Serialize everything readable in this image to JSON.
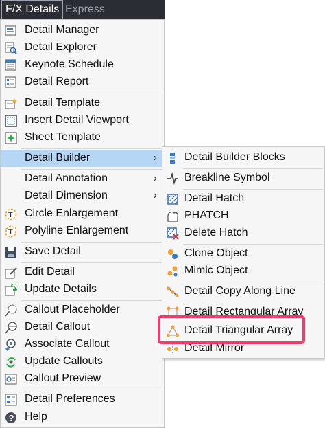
{
  "menubar": {
    "tabs": [
      {
        "label": "F/X Details"
      },
      {
        "label": "Express"
      }
    ]
  },
  "main_menu": {
    "items": [
      {
        "label": "Detail Manager",
        "icon": "detail-manager-icon"
      },
      {
        "label": "Detail Explorer",
        "icon": "detail-explorer-icon"
      },
      {
        "label": "Keynote Schedule",
        "icon": "keynote-schedule-icon"
      },
      {
        "label": "Detail Report",
        "icon": "detail-report-icon"
      },
      {
        "label": "Detail Template",
        "icon": "detail-template-icon"
      },
      {
        "label": "Insert Detail Viewport",
        "icon": "insert-viewport-icon"
      },
      {
        "label": "Sheet Template",
        "icon": "sheet-template-icon"
      },
      {
        "label": "Detail Builder",
        "icon": "detail-builder-icon",
        "submenu": true,
        "highlighted": true
      },
      {
        "label": "Detail Annotation",
        "submenu": true
      },
      {
        "label": "Detail Dimension",
        "submenu": true
      },
      {
        "label": "Circle Enlargement",
        "icon": "circle-enlargement-icon"
      },
      {
        "label": "Polyline Enlargement",
        "icon": "polyline-enlargement-icon"
      },
      {
        "label": "Save Detail",
        "icon": "save-detail-icon"
      },
      {
        "label": "Edit Detail",
        "icon": "edit-detail-icon"
      },
      {
        "label": "Update Details",
        "icon": "update-details-icon"
      },
      {
        "label": "Callout Placeholder",
        "icon": "callout-placeholder-icon"
      },
      {
        "label": "Detail Callout",
        "icon": "detail-callout-icon"
      },
      {
        "label": "Associate Callout",
        "icon": "associate-callout-icon"
      },
      {
        "label": "Update Callouts",
        "icon": "update-callouts-icon"
      },
      {
        "label": "Callout Preview",
        "icon": "callout-preview-icon"
      },
      {
        "label": "Detail Preferences",
        "icon": "detail-preferences-icon"
      },
      {
        "label": "Help",
        "icon": "help-icon"
      }
    ],
    "submenu_arrow": "›"
  },
  "sub_menu": {
    "items": [
      {
        "label": "Detail Builder Blocks",
        "icon": "builder-blocks-icon"
      },
      {
        "label": "Breakline Symbol",
        "icon": "breakline-icon"
      },
      {
        "label": "Detail Hatch",
        "icon": "detail-hatch-icon"
      },
      {
        "label": "PHATCH",
        "icon": "phatch-icon"
      },
      {
        "label": "Delete Hatch",
        "icon": "delete-hatch-icon"
      },
      {
        "label": "Clone Object",
        "icon": "clone-object-icon"
      },
      {
        "label": "Mimic Object",
        "icon": "mimic-object-icon"
      },
      {
        "label": "Detail Copy Along Line",
        "icon": "copy-along-line-icon"
      },
      {
        "label": "Detail Rectangular Array",
        "icon": "rectangular-array-icon"
      },
      {
        "label": "Detail Triangular Array",
        "icon": "triangular-array-icon",
        "callout": true
      },
      {
        "label": "Detail Mirror",
        "icon": "detail-mirror-icon"
      }
    ]
  },
  "colors": {
    "highlight": "#b6d6f5",
    "callout_box": "#ee3d6c",
    "menubar": "#2b2d35"
  }
}
